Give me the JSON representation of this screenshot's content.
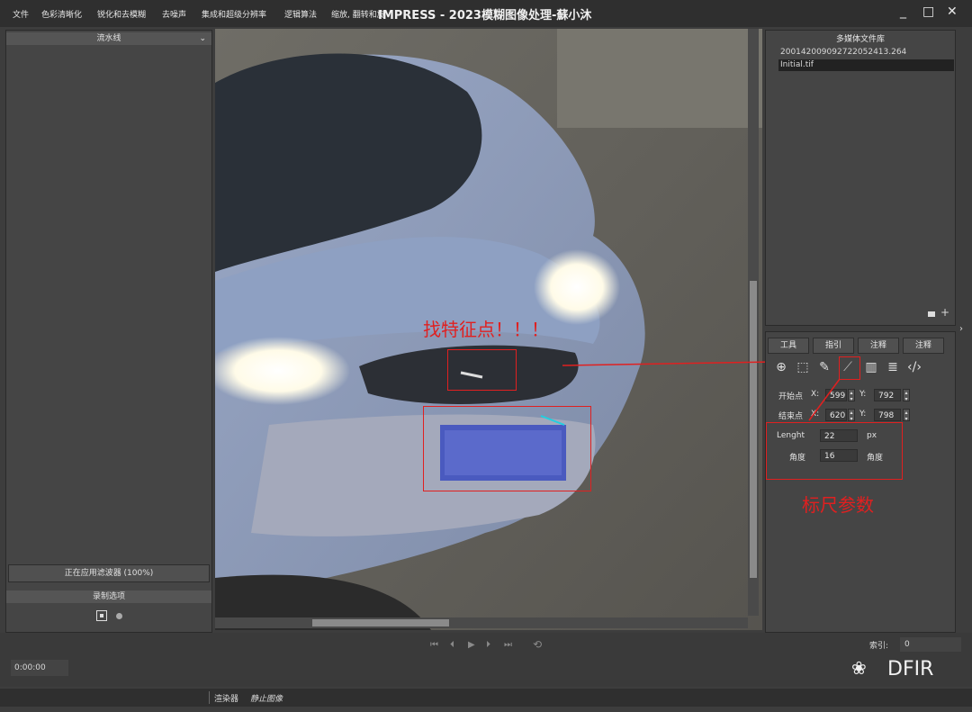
{
  "menu": [
    "文件",
    "色彩清晰化",
    "锐化和去模糊",
    "去噪声",
    "集成和超级分辨率",
    "逻辑算法",
    "缩放, 翻转和旋转"
  ],
  "app_title": "IMPRESS - 2023模糊图像处理-蘇小沐",
  "window_controls": {
    "minimize": "_",
    "maximize": "□",
    "close": "✕"
  },
  "left_panel": {
    "pipeline_title": "流水线",
    "filter_status": "正在应用滤波器 (100%)",
    "record_title": "录制选项"
  },
  "media_library": {
    "title": "多媒体文件库",
    "files": [
      "20014200909272205241​3.264",
      "Initial.tif"
    ],
    "selected_index": 1,
    "add_icon": "+"
  },
  "tools_panel": {
    "tabs": [
      "工具",
      "指引",
      "注释",
      "注释"
    ],
    "icons": [
      "zoom-icon",
      "crop-icon",
      "eyedropper-icon",
      "ruler-icon",
      "histogram-icon",
      "lines-icon",
      "code-icon"
    ],
    "start_label": "开始点",
    "end_label": "结束点",
    "x_label": "X:",
    "y_label": "Y:",
    "start_x": "599",
    "start_y": "792",
    "end_x": "620",
    "end_y": "798",
    "length_label": "Lenght",
    "length_value": "22",
    "length_unit": "px",
    "angle_label": "角度",
    "angle_value": "16",
    "angle_unit": "角度"
  },
  "annotations": {
    "feature_points": "找特征点！！！",
    "ruler_params": "标尺参数"
  },
  "playback": {
    "time": "0:00:00",
    "index_label": "索引:",
    "index_value": "0",
    "controls": [
      "⏮",
      "⏴",
      "▶",
      "⏵",
      "⏭",
      "⟲"
    ]
  },
  "statusbar": {
    "renderer_label": "渲染器",
    "renderer_value": "静止图像"
  },
  "watermark": "DFIR",
  "colors": {
    "annotation_red": "#e02020",
    "accent_cyan": "#20d0e0"
  }
}
